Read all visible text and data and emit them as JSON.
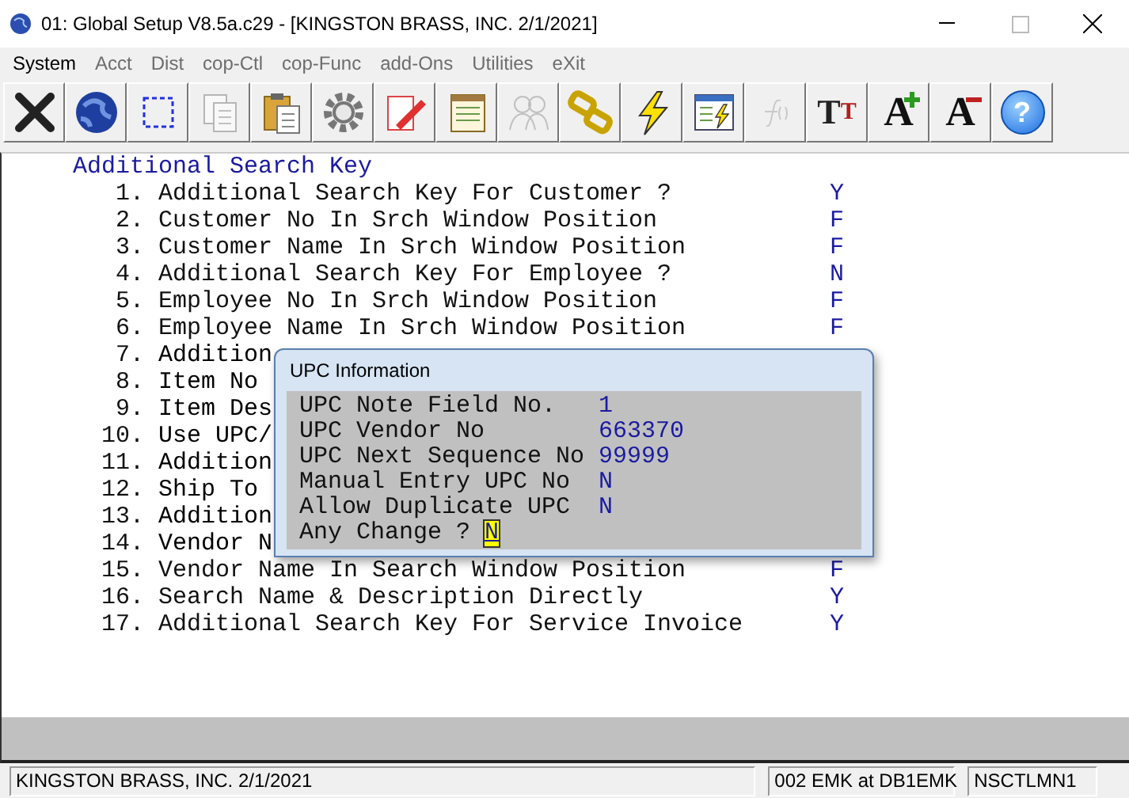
{
  "window": {
    "title": "01: Global Setup V8.5a.c29 - [KINGSTON BRASS, INC. 2/1/2021]"
  },
  "menu": [
    {
      "label": "System",
      "disabled": false
    },
    {
      "label": "Acct",
      "disabled": true
    },
    {
      "label": "Dist",
      "disabled": true
    },
    {
      "label": "cop-Ctl",
      "disabled": true
    },
    {
      "label": "cop-Func",
      "disabled": true
    },
    {
      "label": "add-Ons",
      "disabled": true
    },
    {
      "label": "Utilities",
      "disabled": true
    },
    {
      "label": "eXit",
      "disabled": true
    }
  ],
  "toolbar": [
    {
      "kind": "close",
      "disabled": false
    },
    {
      "kind": "globe",
      "disabled": false
    },
    {
      "kind": "select",
      "disabled": false
    },
    {
      "kind": "copy",
      "disabled": true
    },
    {
      "kind": "paste",
      "disabled": false
    },
    {
      "kind": "gear",
      "disabled": false
    },
    {
      "kind": "edit",
      "disabled": false
    },
    {
      "kind": "notepad",
      "disabled": false
    },
    {
      "kind": "people",
      "disabled": true
    },
    {
      "kind": "chain",
      "disabled": false
    },
    {
      "kind": "lightning",
      "disabled": false
    },
    {
      "kind": "window-lightning",
      "disabled": false
    },
    {
      "kind": "function",
      "disabled": true
    },
    {
      "kind": "font",
      "disabled": false,
      "glyph": "T",
      "glyph_2": "T"
    },
    {
      "kind": "font-larger",
      "disabled": false,
      "glyph": "A"
    },
    {
      "kind": "font-smaller",
      "disabled": false,
      "glyph": "A"
    },
    {
      "kind": "help",
      "disabled": false,
      "glyph": "?"
    }
  ],
  "section_title": "Additional Search Key",
  "settings": [
    {
      "number": "1.",
      "label": "Additional Search Key For Customer ?",
      "value": "Y"
    },
    {
      "number": "2.",
      "label": "Customer No In Srch Window Position",
      "value": "F"
    },
    {
      "number": "3.",
      "label": "Customer Name In Srch Window Position",
      "value": "F"
    },
    {
      "number": "4.",
      "label": "Additional Search Key For Employee ?",
      "value": "N"
    },
    {
      "number": "5.",
      "label": "Employee No In Srch Window Position",
      "value": "F"
    },
    {
      "number": "6.",
      "label": "Employee Name In Srch Window Position",
      "value": "F"
    },
    {
      "number": "7.",
      "label": "Addition"
    },
    {
      "number": "8.",
      "label": "Item No"
    },
    {
      "number": "9.",
      "label": "Item Des"
    },
    {
      "number": "10.",
      "label": "Use UPC/"
    },
    {
      "number": "11.",
      "label": "Addition"
    },
    {
      "number": "12.",
      "label": "Ship To"
    },
    {
      "number": "13.",
      "label": "Addition"
    },
    {
      "number": "14.",
      "label": "Vendor N"
    },
    {
      "number": "15.",
      "label": "Vendor Name In Search Window Position",
      "value": "F"
    },
    {
      "number": "16.",
      "label": "Search Name & Description Directly",
      "value": "Y"
    },
    {
      "number": "17.",
      "label": "Additional Search Key For Service Invoice",
      "value": "Y"
    }
  ],
  "dialog": {
    "title": "UPC Information",
    "fields": [
      {
        "label": "UPC Note Field No.",
        "value": "1"
      },
      {
        "label": "UPC Vendor No",
        "value": "663370"
      },
      {
        "label": "UPC Next Sequence No",
        "value": "99999"
      },
      {
        "label": "Manual Entry UPC No",
        "value": "N"
      },
      {
        "label": "Allow Duplicate UPC",
        "value": "N"
      }
    ],
    "prompt": {
      "label": "Any Change ?",
      "value": "N",
      "focused": true
    }
  },
  "status_bar": [
    "KINGSTON BRASS, INC. 2/1/2021",
    "002 EMK at DB1EMK",
    "NSCTLMN1"
  ]
}
